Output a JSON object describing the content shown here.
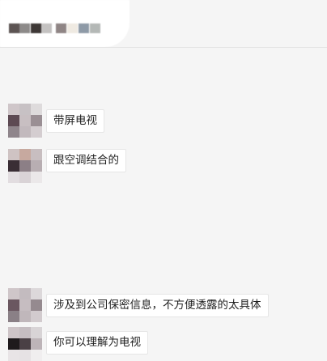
{
  "messages": [
    {
      "text": "带屏电视"
    },
    {
      "text": "跟空调结合的"
    },
    {
      "text": "涉及到公司保密信息，不方便透露的太具体"
    },
    {
      "text": "你可以理解为电视"
    }
  ]
}
